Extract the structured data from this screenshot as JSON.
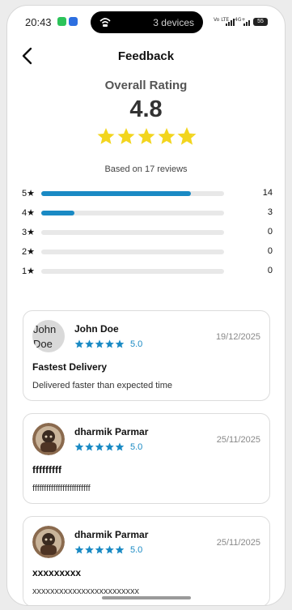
{
  "status_bar": {
    "time": "20:43",
    "pill_text": "3 devices",
    "sim1": "Vo LTE",
    "sim2": "4G+",
    "battery": "55"
  },
  "header": {
    "title": "Feedback"
  },
  "overall": {
    "label": "Overall Rating",
    "value": "4.8",
    "stars": 4.8,
    "based_on": "Based on 17 reviews"
  },
  "distribution": [
    {
      "label": "5★",
      "count": "14",
      "fraction": 0.82
    },
    {
      "label": "4★",
      "count": "3",
      "fraction": 0.18
    },
    {
      "label": "3★",
      "count": "0",
      "fraction": 0
    },
    {
      "label": "2★",
      "count": "0",
      "fraction": 0
    },
    {
      "label": "1★",
      "count": "0",
      "fraction": 0
    }
  ],
  "reviews": [
    {
      "name": "John Doe",
      "avatar_text": "John Doe",
      "rating": "5.0",
      "date": "19/12/2025",
      "title": "Fastest Delivery",
      "body": "Delivered faster than expected time"
    },
    {
      "name": "dharmik Parmar",
      "rating": "5.0",
      "date": "25/11/2025",
      "title": "fffffffff",
      "body": "fffffffffffffffffffffffff"
    },
    {
      "name": "dharmik Parmar",
      "rating": "5.0",
      "date": "25/11/2025",
      "title": "xxxxxxxxx",
      "body": "xxxxxxxxxxxxxxxxxxxxxxxx"
    }
  ],
  "colors": {
    "accent": "#1a8ac4",
    "star": "#f2d51e",
    "small_star": "#1a8ac4"
  },
  "icons": {
    "back": "chevron-left-icon",
    "star": "star-icon",
    "avatar": "user-photo"
  }
}
